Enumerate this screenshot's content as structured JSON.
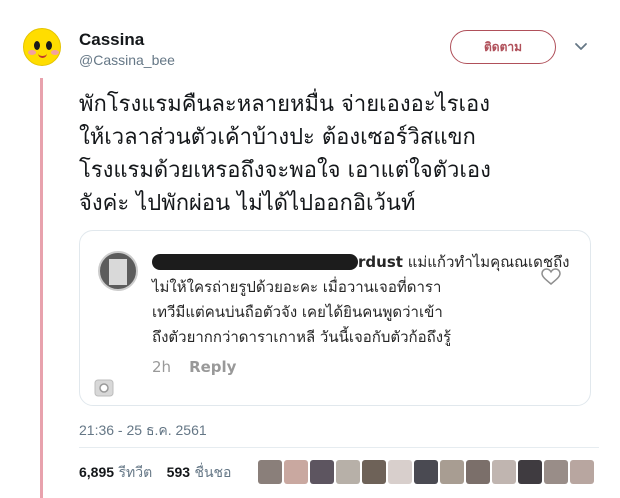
{
  "user": {
    "display_name": "Cassina",
    "handle": "@Cassina_bee",
    "follow_label": "ติดตาม"
  },
  "tweet": {
    "lines": [
      "พักโรงแรมคืนละหลายหมื่น จ่ายเองอะไรเอง",
      "ให้เวลาส่วนตัวเค้าบ้างปะ ต้องเซอร์วิสแขก",
      "โรงแรมด้วยเหรอถึงจะพอใจ เอาแต่ใจตัวเอง",
      "จังค่ะ ไปพักผ่อน ไม่ได้ไปออกอิเว้นท์"
    ]
  },
  "quoted_comment": {
    "name_suffix": "rdust",
    "line1": "แม่แก้วทำไมคุณณเดชถึง",
    "line2": "ไม่ให้ใครถ่ายรูปด้วยอะคะ เมื่อวานเจอที่ดารา",
    "line3": "เทวีมีแต่คนบ่นถือตัวจัง เคยได้ยินคนพูดว่าเข้า",
    "line4": "ถึงตัวยากกว่าดาราเกาหลี วันนี้เจอกับตัวก้อถึงรู้",
    "age": "2h",
    "reply_label": "Reply"
  },
  "timestamp": "21:36 - 25 ธ.ค. 2561",
  "stats": {
    "retweets_count": "6,895",
    "retweets_label": "รีทวีต",
    "likes_count": "593",
    "likes_label": "ชื่นชอ"
  },
  "colors": {
    "accent": "#b0505a",
    "thread_line": "#e8a2ad",
    "secondary_text": "#657786"
  },
  "likers": [
    {
      "color": "#8a7f7a"
    },
    {
      "color": "#c9a8a0"
    },
    {
      "color": "#5d5560"
    },
    {
      "color": "#b7b0a8"
    },
    {
      "color": "#6e6258"
    },
    {
      "color": "#d8cfcc"
    },
    {
      "color": "#4a4a52"
    },
    {
      "color": "#a89d92"
    },
    {
      "color": "#7b6f6a"
    },
    {
      "color": "#c0b5b0"
    },
    {
      "color": "#3f3b40"
    },
    {
      "color": "#998d88"
    },
    {
      "color": "#b8a6a0"
    }
  ]
}
